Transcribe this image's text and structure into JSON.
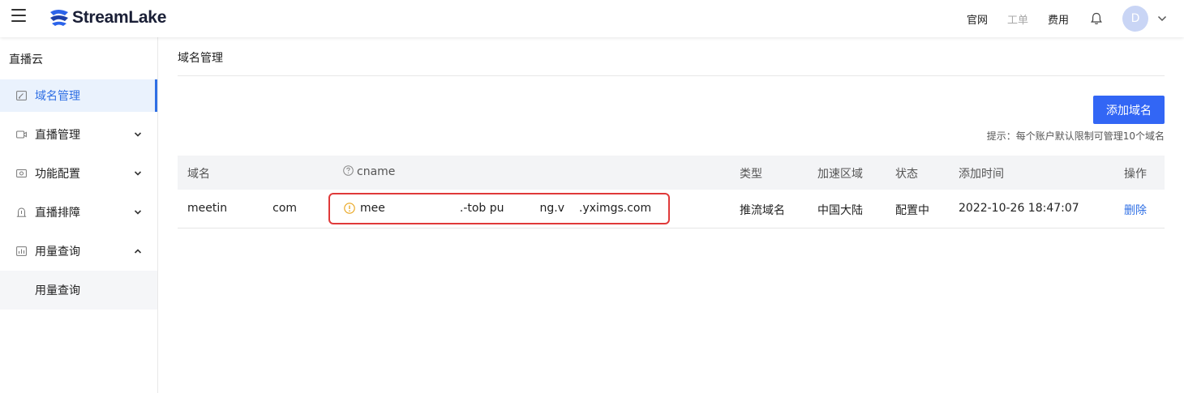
{
  "header": {
    "brand": "StreamLake",
    "nav": [
      {
        "label": "官网",
        "disabled": false
      },
      {
        "label": "工单",
        "disabled": true
      },
      {
        "label": "费用",
        "disabled": false
      }
    ],
    "avatar_letter": "D",
    "icons": [
      "menu-icon",
      "bell-icon",
      "chevron-down-icon"
    ]
  },
  "sidebar": {
    "title": "直播云",
    "items": [
      {
        "label": "域名管理",
        "icon": "edit-icon",
        "active": true
      },
      {
        "label": "直播管理",
        "icon": "video-icon",
        "expand": "down"
      },
      {
        "label": "功能配置",
        "icon": "config-icon",
        "expand": "down"
      },
      {
        "label": "直播排障",
        "icon": "troubleshoot-icon",
        "expand": "down"
      },
      {
        "label": "用量查询",
        "icon": "chart-icon",
        "expand": "up"
      }
    ],
    "sub_items": [
      {
        "label": "用量查询"
      }
    ]
  },
  "main": {
    "page_title": "域名管理",
    "add_button": "添加域名",
    "hint": "提示：每个账户默认限制可管理10个域名",
    "table": {
      "columns": [
        "域名",
        "cname",
        "类型",
        "加速区域",
        "状态",
        "添加时间",
        "操作"
      ],
      "rows": [
        {
          "domain_start": "meetin",
          "domain_end": "com",
          "cname_parts": [
            "mee",
            ".-tob pu",
            "ng.v",
            ".yximgs.com"
          ],
          "type": "推流域名",
          "region": "中国大陆",
          "status": "配置中",
          "added": "2022-10-26 18:47:07",
          "action": "删除"
        }
      ]
    }
  },
  "colors": {
    "accent": "#3266f5",
    "highlight_box": "#e03a3a",
    "link": "#2f6fe4"
  }
}
